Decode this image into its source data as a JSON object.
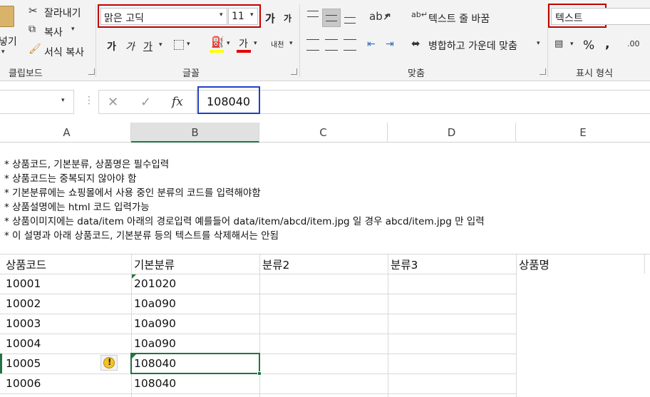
{
  "ribbon": {
    "clipboard": {
      "paste_partial": "넣기",
      "cut": "잘라내기",
      "copy": "복사",
      "format_painter": "서식 복사",
      "group_label": "클립보드"
    },
    "font": {
      "font_name": "맑은 고딕",
      "font_size": "11",
      "grow_label": "가",
      "shrink_label": "가",
      "bold": "가",
      "italic": "가",
      "underline": "가",
      "font_color_label": "가",
      "phonetic": "내천",
      "group_label": "글꼴"
    },
    "alignment": {
      "wrap_text": "텍스트 줄 바꿈",
      "merge_center": "병합하고 가운데 맞춤",
      "group_label": "맞춤"
    },
    "number": {
      "format": "텍스트",
      "percent": "%",
      "comma": ",",
      "group_label": "표시 형식"
    }
  },
  "formula_bar": {
    "cancel": "✕",
    "enter": "✓",
    "fx": "fx",
    "value": "108040"
  },
  "sheet": {
    "columns": [
      "A",
      "B",
      "C",
      "D",
      "E"
    ],
    "notes": [
      "* 상품코드, 기본분류, 상품명은 필수입력",
      "* 상품코드는 중복되지 않아야 함",
      "* 기본분류에는 쇼핑몰에서 사용 중인 분류의 코드를 입력해야함",
      "* 상품설명에는 html 코드 입력가능",
      "* 상품이미지에는 data/item 아래의 경로입력 예를들어 data/item/abcd/item.jpg 일 경우 abcd/item.jpg 만 입력",
      "* 이 설명과 아래 상품코드, 기본분류 등의 텍스트를 삭제해서는 안됨"
    ],
    "headers": [
      "상품코드",
      "기본분류",
      "분류2",
      "분류3",
      "상품명"
    ],
    "rows": [
      [
        "10001",
        "201020"
      ],
      [
        "10002",
        "10a090"
      ],
      [
        "10003",
        "10a090"
      ],
      [
        "10004",
        "10a090"
      ],
      [
        "10005",
        "108040"
      ],
      [
        "10006",
        "108040"
      ]
    ],
    "warning_icon": "!"
  }
}
